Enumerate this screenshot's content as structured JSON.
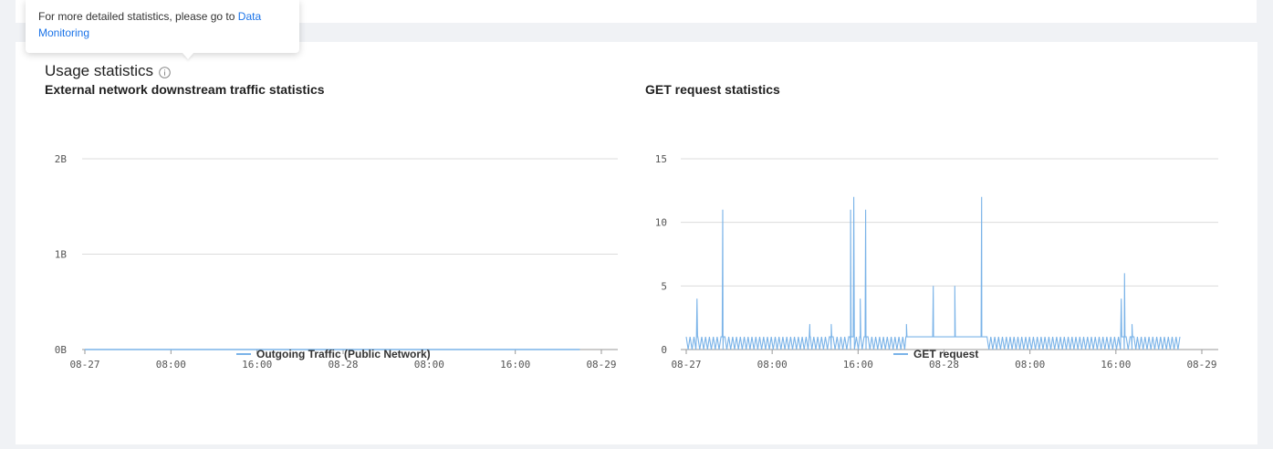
{
  "tooltip": {
    "text": "For more detailed statistics, please go to ",
    "link_text": "Data Monitoring"
  },
  "section": {
    "title": "Usage statistics",
    "info_icon": "info-icon"
  },
  "colors": {
    "series": "#7ab3e8",
    "link": "#1a73e8",
    "grid": "#dcdcdc"
  },
  "chart_data": [
    {
      "type": "line",
      "title": "External network downstream traffic statistics",
      "x_ticks": [
        "08-27",
        "08:00",
        "16:00",
        "08-28",
        "08:00",
        "16:00",
        "08-29"
      ],
      "y_ticks": [
        "2B",
        "1B",
        "0B"
      ],
      "ylim": [
        0,
        2
      ],
      "grid": true,
      "legend_position": "bottom-center",
      "series": [
        {
          "name": "Outgoing Traffic (Public Network)",
          "x": [
            0,
            46
          ],
          "y": [
            0,
            0
          ]
        }
      ]
    },
    {
      "type": "line",
      "title": "GET request statistics",
      "x_ticks": [
        "08-27",
        "08:00",
        "16:00",
        "08-28",
        "08:00",
        "16:00",
        "08-29"
      ],
      "y_ticks": [
        "15",
        "10",
        "5",
        "0"
      ],
      "ylim": [
        0,
        15
      ],
      "grid": true,
      "legend_position": "bottom-center",
      "series": [
        {
          "name": "GET request",
          "spikes": [
            {
              "x": 1.0,
              "y": 4
            },
            {
              "x": 3.4,
              "y": 11
            },
            {
              "x": 11.5,
              "y": 2
            },
            {
              "x": 13.5,
              "y": 2
            },
            {
              "x": 15.3,
              "y": 11
            },
            {
              "x": 15.6,
              "y": 12
            },
            {
              "x": 16.2,
              "y": 4
            },
            {
              "x": 16.7,
              "y": 11
            },
            {
              "x": 20.5,
              "y": 2
            },
            {
              "x": 23.0,
              "y": 5
            },
            {
              "x": 25.0,
              "y": 5
            },
            {
              "x": 27.5,
              "y": 12
            },
            {
              "x": 40.5,
              "y": 4
            },
            {
              "x": 40.8,
              "y": 6
            },
            {
              "x": 41.5,
              "y": 2
            }
          ],
          "baseline_segments": [
            {
              "from": 0,
              "to": 20.5,
              "pattern": "oscillating",
              "low": 0,
              "high": 1
            },
            {
              "from": 20.5,
              "to": 28.0,
              "pattern": "flat",
              "value": 1
            },
            {
              "from": 28.0,
              "to": 42.0,
              "pattern": "oscillating",
              "low": 0,
              "high": 1
            },
            {
              "from": 42.0,
              "to": 46.0,
              "pattern": "oscillating",
              "low": 0,
              "high": 1
            }
          ]
        }
      ]
    }
  ]
}
